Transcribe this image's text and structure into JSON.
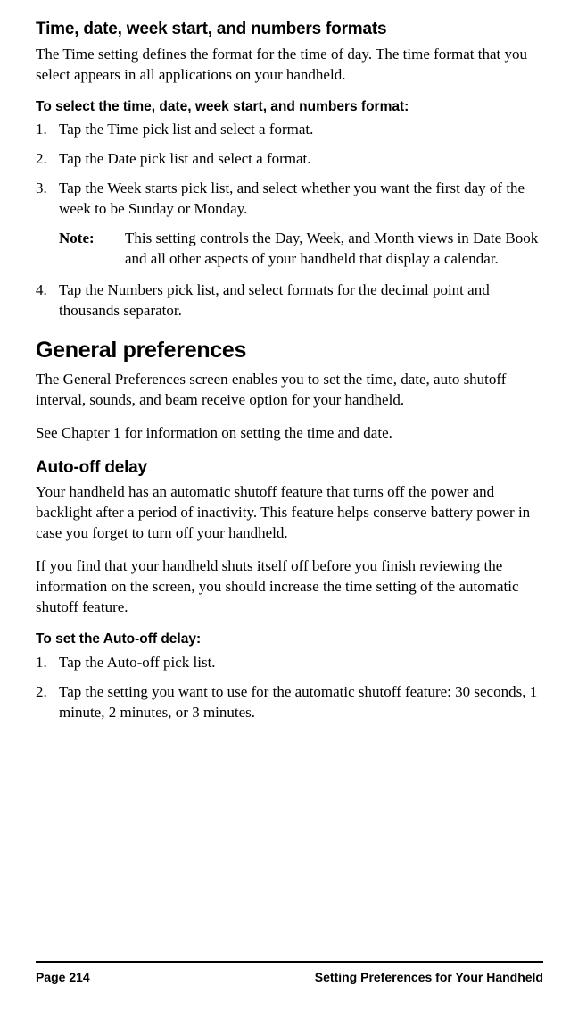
{
  "section1": {
    "title": "Time, date, week start, and numbers formats",
    "intro": "The Time setting defines the format for the time of day. The time format that you select appears in all applications on your handheld.",
    "procedure_title": "To select the time, date, week start, and numbers format:",
    "steps": [
      "Tap the Time pick list and select a format.",
      "Tap the Date pick list and select a format.",
      "Tap the Week starts pick list, and select whether you want the first day of the week to be Sunday or Monday."
    ],
    "note_label": "Note:",
    "note_text": "This setting controls the Day, Week, and Month views in Date Book and all other aspects of your handheld that display a calendar.",
    "step4": "Tap the Numbers pick list, and select formats for the decimal point and thousands separator."
  },
  "section2": {
    "title": "General preferences",
    "intro": "The General Preferences screen enables you to set the time, date, auto shutoff interval, sounds, and beam receive option for your handheld.",
    "see_ref": "See Chapter 1 for information on setting the time and date."
  },
  "section3": {
    "title": "Auto-off delay",
    "para1": "Your handheld has an automatic shutoff feature that turns off the power and backlight after a period of inactivity. This feature helps conserve battery power in case you forget to turn off your handheld.",
    "para2": "If you find that your handheld shuts itself off before you finish reviewing the information on the screen, you should increase the time setting of the automatic shutoff feature.",
    "procedure_title": "To set the Auto-off delay:",
    "steps": [
      "Tap the Auto-off pick list.",
      "Tap the setting you want to use for the automatic shutoff feature: 30 seconds, 1 minute, 2 minutes, or 3 minutes."
    ]
  },
  "footer": {
    "page": "Page 214",
    "chapter": "Setting Preferences for Your Handheld"
  }
}
